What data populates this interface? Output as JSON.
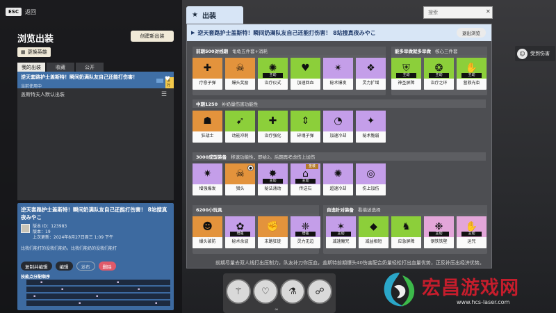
{
  "left": {
    "esc_key": "ESC",
    "esc_label": "返回",
    "title": "浏览出装",
    "create_button": "创建新出装",
    "change_hero_button": "更换英雄",
    "tabs": [
      "我的出装",
      "收藏",
      "公开"
    ],
    "list": [
      {
        "title": "逆天套路护士盖斯特！瞬间奶满队友自己还能打伤害！",
        "subtitle": "当前使用中",
        "badge": "进行"
      },
      {
        "title": "盖斯特夫人默认出装"
      }
    ],
    "detail": {
      "title": "逆天套路护士盖斯特！瞬间奶满队友自己还能打伤害！ 8站搜真夜みやこ",
      "version_id": "版本 ID：123983",
      "version": "版本：19",
      "updated": "上次更新：2024年8月27日周三 1:09 下午",
      "desc": "比我们能打的没我们能奶，比我们能奶的没我们能打",
      "buttons": [
        "复制并编辑",
        "编辑",
        "发布",
        "删除"
      ],
      "skill_title": "技能点分配顺序"
    }
  },
  "main": {
    "tab_label": "出装",
    "search_placeholder": "搜索",
    "header_title": "逆天套路护士盖斯特！瞬间奶满队友自己还能打伤害！ 8站搜真夜みやこ",
    "exit_button": "退出浏览",
    "sections": [
      {
        "title": "前期500对线期",
        "sub": "龟龟五件套+消耗",
        "cards": [
          {
            "name": "疗愈子弹",
            "color": "o",
            "icon": "cross-icon",
            "glyph": "✚"
          },
          {
            "name": "爆头奖励",
            "color": "o",
            "icon": "headshot-icon",
            "glyph": "☠"
          },
          {
            "name": "治疗仪式",
            "color": "g",
            "icon": "ritual-icon",
            "glyph": "✺",
            "tag": "主动"
          },
          {
            "name": "加速回血",
            "color": "g",
            "icon": "heart-rate-icon",
            "glyph": "♥"
          },
          {
            "name": "秘术爆发",
            "color": "p",
            "icon": "burst-icon",
            "glyph": "✴"
          },
          {
            "name": "灵力扩增",
            "color": "p",
            "icon": "amplify-icon",
            "glyph": "❖"
          }
        ]
      },
      {
        "title": "能多早做就多早做",
        "sub": "核心三件套",
        "cards": [
          {
            "name": "神圣屏障",
            "color": "g",
            "icon": "shield-icon",
            "glyph": "⛨",
            "tag": "主动"
          },
          {
            "name": "治疗之环",
            "color": "g",
            "icon": "ring-icon",
            "glyph": "❂",
            "tag": "主动"
          },
          {
            "name": "营救光束",
            "color": "g",
            "icon": "beam-icon",
            "glyph": "✋",
            "tag": "主动"
          }
        ]
      },
      {
        "title": "中期1250",
        "sub": "补奶量伤害功能性",
        "cards": [
          {
            "name": "狂战士",
            "color": "o",
            "icon": "berserker-icon",
            "glyph": "☗"
          },
          {
            "name": "动能冲刺",
            "color": "g",
            "icon": "dash-icon",
            "glyph": "➹"
          },
          {
            "name": "治疗强化",
            "color": "g",
            "icon": "heal-boost-icon",
            "glyph": "✚"
          },
          {
            "name": "碎魂子弹",
            "color": "g",
            "icon": "soul-bullet-icon",
            "glyph": "⇕"
          },
          {
            "name": "加速冷却",
            "color": "p",
            "icon": "cooldown-icon",
            "glyph": "◔"
          },
          {
            "name": "秘术脆弱",
            "color": "p",
            "icon": "vulnerable-icon",
            "glyph": "✦"
          }
        ]
      },
      {
        "title": "3000成型装备",
        "sub": "移速功能性，即给2。后期再考虑伤上加伤",
        "cards": [
          {
            "name": "增强爆发",
            "color": "p",
            "icon": "enhanced-burst-icon",
            "glyph": "✷"
          },
          {
            "name": "猎头",
            "color": "o",
            "icon": "hunter-icon",
            "glyph": "☠",
            "corner": "●"
          },
          {
            "name": "秘法涌动",
            "color": "p",
            "icon": "surge-icon",
            "glyph": "✸",
            "tag": "主动"
          },
          {
            "name": "传送石",
            "color": "p",
            "icon": "teleport-icon",
            "glyph": "⌂",
            "tag": "主动",
            "top_tag": "金装"
          },
          {
            "name": "超速冷却",
            "color": "p",
            "icon": "super-cooldown-icon",
            "glyph": "✺"
          },
          {
            "name": "伤上加伤",
            "color": "p",
            "icon": "escalate-icon",
            "glyph": "◎"
          }
        ]
      },
      {
        "title": "6200小玩具",
        "sub": "",
        "cards": [
          {
            "name": "爆头破防",
            "color": "o",
            "icon": "crit-break-icon",
            "glyph": "☻"
          },
          {
            "name": "秘术余波",
            "color": "p",
            "icon": "aftershock-icon",
            "glyph": "✿",
            "tag": "增强"
          },
          {
            "name": "末路狂徒",
            "color": "o",
            "icon": "desperado-icon",
            "glyph": "✊"
          },
          {
            "name": "灵力无边",
            "color": "p",
            "icon": "boundless-icon",
            "glyph": "❈",
            "tag": "增强"
          }
        ]
      },
      {
        "title": "自选针对装备",
        "sub": "看描述选择",
        "cards": [
          {
            "name": "减速魔咒",
            "color": "p",
            "icon": "slow-hex-icon",
            "glyph": "✶",
            "tag": "主动"
          },
          {
            "name": "减益相短",
            "color": "g",
            "icon": "debuff-icon",
            "glyph": "◆"
          },
          {
            "name": "应急屏障",
            "color": "g",
            "icon": "barrier-icon",
            "glyph": "♞"
          },
          {
            "name": "钢铁铁壁",
            "color": "pk",
            "icon": "iron-wall-icon",
            "glyph": "❉",
            "tag": "主动"
          },
          {
            "name": "运咒",
            "color": "pk",
            "icon": "curse-icon",
            "glyph": "✋",
            "tag": "主动"
          }
        ]
      }
    ],
    "bottom_text": "前期尽量去双人线打出压制力，队友补刀你压血，盖斯特前期爆头40伤害配合奶量轻松打出血量优势，正反补压出经济优势。"
  },
  "wheel": {
    "slots": [
      "dagger-spin-icon",
      "heart-ring-icon",
      "vial-icon",
      "hands-icon"
    ],
    "glyphs": [
      "⚚",
      "♡",
      "⚗",
      "☍"
    ],
    "infinity": "∞"
  },
  "right": {
    "badge_label": "受到伤害"
  },
  "watermark": {
    "text": "宏昌游戏网",
    "url": "www.hcs-laser.com"
  }
}
